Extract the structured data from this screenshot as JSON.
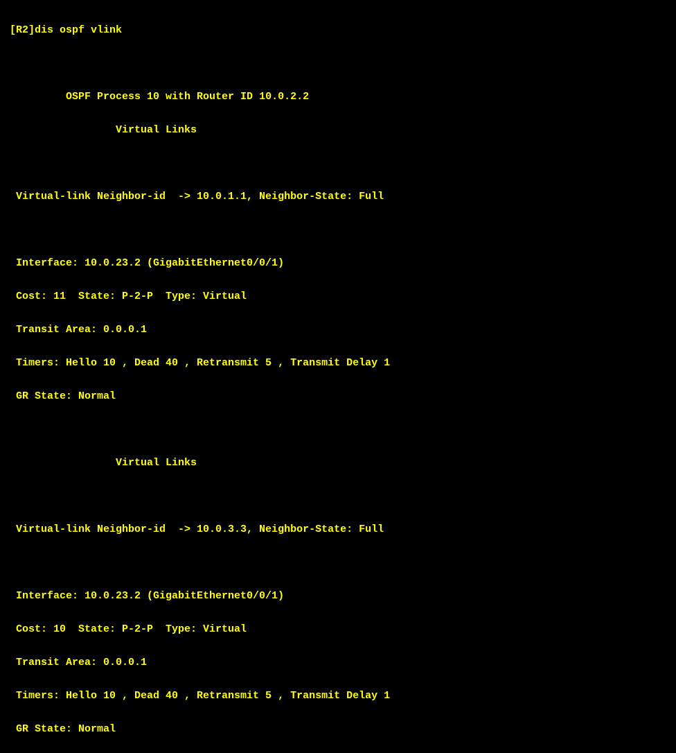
{
  "terminal": {
    "prompt_line": "[R2]dis ospf vlink",
    "blank": "",
    "header1": "\t OSPF Process 10 with Router ID 10.0.2.2",
    "header2": "\t\t Virtual Links",
    "vlink1": {
      "neighbor_line": " Virtual-link Neighbor-id  -> 10.0.1.1, Neighbor-State: Full",
      "interface_line": " Interface: 10.0.23.2 (GigabitEthernet0/0/1)",
      "cost_line": " Cost: 11  State: P-2-P  Type: Virtual",
      "transit_line": " Transit Area: 0.0.0.1",
      "timers_line": " Timers: Hello 10 , Dead 40 , Retransmit 5 , Transmit Delay 1",
      "gr_line": " GR State: Normal"
    },
    "header3": "\t\t Virtual Links",
    "vlink2": {
      "neighbor_line": " Virtual-link Neighbor-id  -> 10.0.3.3, Neighbor-State: Full",
      "interface_line": " Interface: 10.0.23.2 (GigabitEthernet0/0/1)",
      "cost_line": " Cost: 10  State: P-2-P  Type: Virtual",
      "transit_line": " Transit Area: 0.0.0.1",
      "timers_line": " Timers: Hello 10 , Dead 40 , Retransmit 5 , Transmit Delay 1",
      "gr_line": " GR State: Normal"
    }
  }
}
